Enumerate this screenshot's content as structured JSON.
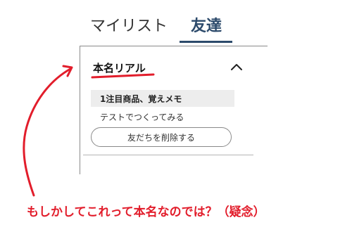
{
  "tabs": [
    {
      "label": "マイリスト",
      "active": false
    },
    {
      "label": "友達",
      "active": true
    }
  ],
  "colors": {
    "active_tab": "#2c4a6b",
    "annotation": "#e21d2b",
    "memo_row_bg": "#ededed"
  },
  "panel": {
    "title": "本名リアル",
    "memo_title": "1注目商品、覚えメモ",
    "memo_text": "テストでつくってみる",
    "delete_button_label": "友だちを削除する",
    "collapse_icon": "chevron-up-icon"
  },
  "annotation": {
    "text": "もしかしてこれって本名なのでは？（疑念）"
  }
}
